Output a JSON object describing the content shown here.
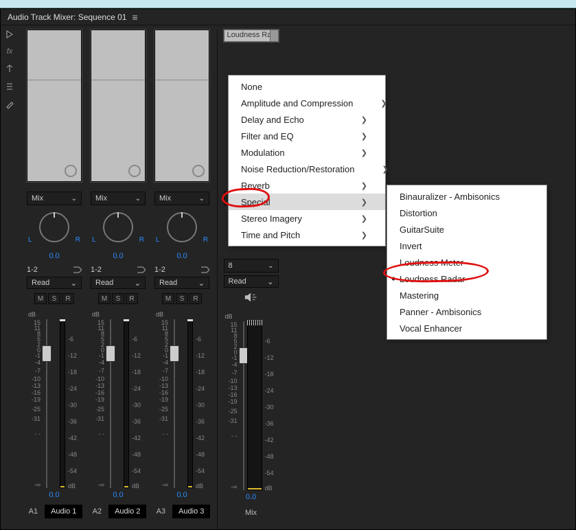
{
  "title": "Audio Track Mixer: Sequence 01",
  "mix_label": "Mix",
  "pan": {
    "L": "L",
    "R": "R",
    "value": "0.0"
  },
  "read_label": "Read",
  "msr": {
    "m": "M",
    "s": "S",
    "r": "R"
  },
  "db_label": "dB",
  "vol_value": "0.0",
  "tracks": [
    {
      "route": "1-2",
      "tag": "A1",
      "name": "Audio 1"
    },
    {
      "route": "1-2",
      "tag": "A2",
      "name": "Audio 2"
    },
    {
      "route": "1-2",
      "tag": "A3",
      "name": "Audio 3"
    }
  ],
  "mix_track": {
    "slot": "Loudness Rad",
    "route": "8",
    "name": "Mix"
  },
  "scale_left": [
    {
      "v": "15",
      "p": 0
    },
    {
      "v": "11",
      "p": 8
    },
    {
      "v": "8",
      "p": 16
    },
    {
      "v": "5",
      "p": 24
    },
    {
      "v": "2",
      "p": 32
    },
    {
      "v": "0",
      "p": 40
    },
    {
      "v": "-1",
      "p": 48
    },
    {
      "v": "-4",
      "p": 58
    },
    {
      "v": "-7",
      "p": 70
    },
    {
      "v": "-10",
      "p": 82
    },
    {
      "v": "-13",
      "p": 92
    },
    {
      "v": "-16",
      "p": 102
    },
    {
      "v": "-19",
      "p": 112
    },
    {
      "v": "-25",
      "p": 126
    },
    {
      "v": "-31",
      "p": 140
    },
    {
      "v": "- -",
      "p": 162
    },
    {
      "v": "-∞",
      "p": 236
    }
  ],
  "scale_right": [
    {
      "v": "-6",
      "p": 24
    },
    {
      "v": "-12",
      "p": 48
    },
    {
      "v": "-18",
      "p": 72
    },
    {
      "v": "-24",
      "p": 96
    },
    {
      "v": "-30",
      "p": 120
    },
    {
      "v": "-36",
      "p": 144
    },
    {
      "v": "-42",
      "p": 168
    },
    {
      "v": "-48",
      "p": 192
    },
    {
      "v": "-54",
      "p": 216
    },
    {
      "v": "dB",
      "p": 238
    }
  ],
  "menu1": [
    {
      "label": "None",
      "sub": false
    },
    {
      "label": "Amplitude and Compression",
      "sub": true
    },
    {
      "label": "Delay and Echo",
      "sub": true
    },
    {
      "label": "Filter and EQ",
      "sub": true
    },
    {
      "label": "Modulation",
      "sub": true
    },
    {
      "label": "Noise Reduction/Restoration",
      "sub": true
    },
    {
      "label": "Reverb",
      "sub": true
    },
    {
      "label": "Special",
      "sub": true,
      "hl": true
    },
    {
      "label": "Stereo Imagery",
      "sub": true
    },
    {
      "label": "Time and Pitch",
      "sub": true
    }
  ],
  "menu2": [
    {
      "label": "Binauralizer - Ambisonics"
    },
    {
      "label": "Distortion"
    },
    {
      "label": "GuitarSuite"
    },
    {
      "label": "Invert"
    },
    {
      "label": "Loudness Meter"
    },
    {
      "label": "Loudness Radar",
      "dot": true
    },
    {
      "label": "Mastering"
    },
    {
      "label": "Panner - Ambisonics"
    },
    {
      "label": "Vocal Enhancer"
    }
  ]
}
